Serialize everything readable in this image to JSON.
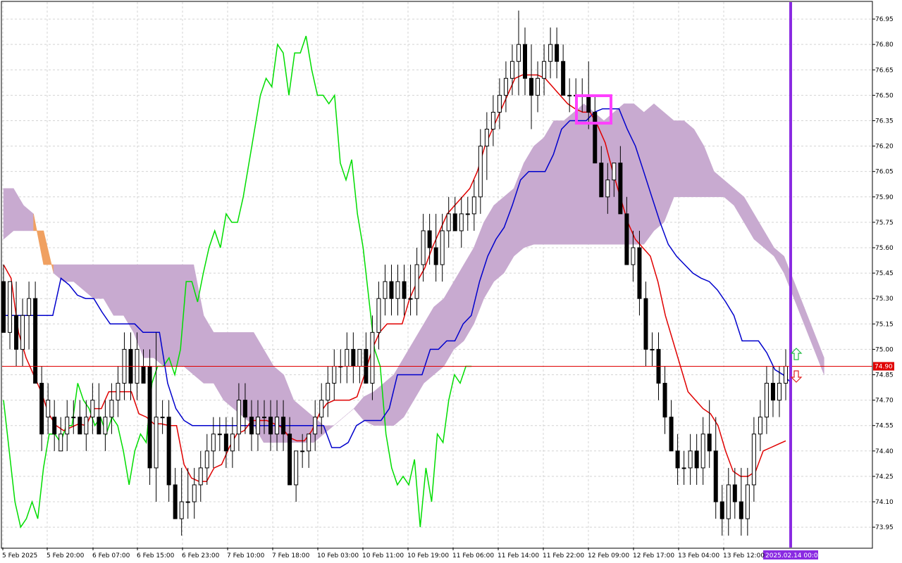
{
  "colors": {
    "background": "#ffffff",
    "grid": "#d4d4d4",
    "bull_candle": "#ffffff",
    "bear_candle": "#000000",
    "tenkan": "#e00000",
    "kijun": "#0000cc",
    "chikou": "#00dd00",
    "kumo_bull": "#c8aad0",
    "kumo_bear": "#f0a060",
    "current_price_line": "#e00000",
    "current_time_line": "#8a2be2",
    "highlight_box": "#ff40ff",
    "price_tag_bg": "#e00000",
    "date_tag_bg": "#8a2be2"
  },
  "chart_data": {
    "type": "candlestick",
    "indicator": "Ichimoku Kinko Hyo",
    "ylim": [
      73.83,
      77.05
    ],
    "y_ticks": [
      "76.95",
      "76.80",
      "76.65",
      "76.50",
      "76.35",
      "76.20",
      "76.05",
      "75.90",
      "75.75",
      "75.60",
      "75.45",
      "75.30",
      "75.15",
      "75.00",
      "74.85",
      "74.70",
      "74.55",
      "74.40",
      "74.25",
      "74.10",
      "73.95"
    ],
    "x_tick_labels": [
      "5 Feb 2025",
      "5 Feb 20:00",
      "6 Feb 07:00",
      "6 Feb 15:00",
      "6 Feb 23:00",
      "7 Feb 10:00",
      "7 Feb 18:00",
      "10 Feb 03:00",
      "10 Feb 11:00",
      "10 Feb 19:00",
      "11 Feb 06:00",
      "11 Feb 14:00",
      "11 Feb 22:00",
      "12 Feb 09:00",
      "12 Feb 17:00",
      "13 Feb 04:00",
      "13 Feb 12:00"
    ],
    "current_price": "74.90",
    "current_time_label": "2025.02.14 00:00",
    "candles": [
      [
        75.4,
        75.5,
        75.2,
        75.1
      ],
      [
        75.1,
        75.3,
        75.0,
        75.4
      ],
      [
        75.2,
        75.4,
        74.9,
        75.0
      ],
      [
        75.0,
        75.3,
        74.9,
        75.2
      ],
      [
        75.2,
        75.4,
        75.0,
        75.3
      ],
      [
        75.3,
        75.4,
        74.9,
        74.8
      ],
      [
        74.8,
        74.9,
        74.4,
        74.5
      ],
      [
        74.6,
        74.8,
        74.5,
        74.7
      ],
      [
        74.6,
        74.7,
        74.4,
        74.5
      ],
      [
        74.4,
        74.6,
        74.4,
        74.5
      ],
      [
        74.5,
        74.7,
        74.4,
        74.6
      ],
      [
        74.6,
        74.7,
        74.5,
        74.6
      ],
      [
        74.6,
        74.7,
        74.5,
        74.5
      ],
      [
        74.5,
        74.7,
        74.4,
        74.6
      ],
      [
        74.6,
        74.8,
        74.5,
        74.7
      ],
      [
        74.6,
        74.8,
        74.5,
        74.5
      ],
      [
        74.5,
        74.7,
        74.4,
        74.6
      ],
      [
        74.6,
        74.8,
        74.5,
        74.7
      ],
      [
        74.7,
        74.9,
        74.6,
        74.8
      ],
      [
        74.8,
        75.1,
        74.7,
        75.0
      ],
      [
        75.0,
        75.1,
        74.7,
        74.8
      ],
      [
        74.8,
        75.1,
        74.7,
        75.0
      ],
      [
        74.9,
        75.0,
        74.8,
        74.8
      ],
      [
        74.9,
        75.0,
        74.2,
        74.3
      ],
      [
        74.3,
        75.1,
        74.1,
        74.6
      ],
      [
        74.6,
        74.7,
        74.5,
        74.6
      ],
      [
        74.6,
        74.7,
        74.1,
        74.2
      ],
      [
        74.2,
        74.3,
        74.0,
        74.0
      ],
      [
        74.0,
        74.3,
        73.9,
        74.1
      ],
      [
        74.1,
        74.3,
        74.0,
        74.1
      ],
      [
        74.1,
        74.3,
        74.0,
        74.2
      ],
      [
        74.2,
        74.4,
        74.1,
        74.3
      ],
      [
        74.3,
        74.5,
        74.2,
        74.4
      ],
      [
        74.4,
        74.6,
        74.3,
        74.5
      ],
      [
        74.5,
        74.6,
        74.4,
        74.5
      ],
      [
        74.5,
        74.6,
        74.3,
        74.4
      ],
      [
        74.4,
        74.6,
        74.3,
        74.5
      ],
      [
        74.5,
        74.8,
        74.4,
        74.7
      ],
      [
        74.7,
        74.8,
        74.5,
        74.6
      ],
      [
        74.6,
        74.7,
        74.4,
        74.5
      ],
      [
        74.5,
        74.7,
        74.4,
        74.6
      ],
      [
        74.6,
        74.7,
        74.5,
        74.6
      ],
      [
        74.6,
        74.7,
        74.4,
        74.5
      ],
      [
        74.5,
        74.7,
        74.4,
        74.6
      ],
      [
        74.6,
        74.7,
        74.4,
        74.5
      ],
      [
        74.5,
        74.6,
        74.2,
        74.2
      ],
      [
        74.2,
        74.4,
        74.1,
        74.4
      ],
      [
        74.4,
        74.5,
        74.3,
        74.4
      ],
      [
        74.4,
        74.5,
        74.3,
        74.5
      ],
      [
        74.5,
        74.7,
        74.4,
        74.6
      ],
      [
        74.6,
        74.8,
        74.5,
        74.7
      ],
      [
        74.7,
        74.9,
        74.6,
        74.8
      ],
      [
        74.8,
        75.0,
        74.7,
        74.9
      ],
      [
        74.9,
        75.0,
        74.8,
        74.9
      ],
      [
        74.9,
        75.1,
        74.8,
        75.0
      ],
      [
        75.0,
        75.1,
        74.8,
        74.9
      ],
      [
        74.9,
        75.0,
        74.8,
        75.0
      ],
      [
        75.0,
        75.1,
        74.9,
        74.8
      ],
      [
        74.8,
        75.2,
        74.7,
        75.1
      ],
      [
        75.1,
        75.4,
        75.0,
        75.3
      ],
      [
        75.3,
        75.5,
        75.2,
        75.4
      ],
      [
        75.4,
        75.5,
        75.2,
        75.3
      ],
      [
        75.3,
        75.5,
        75.2,
        75.4
      ],
      [
        75.4,
        75.5,
        75.2,
        75.3
      ],
      [
        75.3,
        75.5,
        75.2,
        75.3
      ],
      [
        75.3,
        75.6,
        75.2,
        75.5
      ],
      [
        75.5,
        75.8,
        75.4,
        75.7
      ],
      [
        75.7,
        75.8,
        75.5,
        75.6
      ],
      [
        75.6,
        75.8,
        75.4,
        75.5
      ],
      [
        75.5,
        75.8,
        75.4,
        75.7
      ],
      [
        75.7,
        75.9,
        75.6,
        75.8
      ],
      [
        75.8,
        75.9,
        75.7,
        75.7
      ],
      [
        75.7,
        75.9,
        75.6,
        75.8
      ],
      [
        75.8,
        75.9,
        75.7,
        75.8
      ],
      [
        75.8,
        76.0,
        75.7,
        75.9
      ],
      [
        75.9,
        76.3,
        75.8,
        76.2
      ],
      [
        76.2,
        76.4,
        76.0,
        76.3
      ],
      [
        76.3,
        76.5,
        76.2,
        76.4
      ],
      [
        76.4,
        76.6,
        76.3,
        76.5
      ],
      [
        76.5,
        76.7,
        76.4,
        76.6
      ],
      [
        76.6,
        76.8,
        76.5,
        76.7
      ],
      [
        76.7,
        77.0,
        76.5,
        76.8
      ],
      [
        76.8,
        76.9,
        76.5,
        76.6
      ],
      [
        76.6,
        76.8,
        76.3,
        76.5
      ],
      [
        76.5,
        76.7,
        76.4,
        76.6
      ],
      [
        76.6,
        76.8,
        76.5,
        76.7
      ],
      [
        76.7,
        76.9,
        76.6,
        76.8
      ],
      [
        76.8,
        76.9,
        76.6,
        76.7
      ],
      [
        76.7,
        76.8,
        76.5,
        76.5
      ],
      [
        76.5,
        76.6,
        76.4,
        76.5
      ],
      [
        76.5,
        76.6,
        76.4,
        76.5
      ],
      [
        76.5,
        76.6,
        76.4,
        76.5
      ],
      [
        76.5,
        76.7,
        76.3,
        76.4
      ],
      [
        76.4,
        76.5,
        76.1,
        76.1
      ],
      [
        76.1,
        76.2,
        75.9,
        75.9
      ],
      [
        75.9,
        76.1,
        75.8,
        76.0
      ],
      [
        76.0,
        76.1,
        75.9,
        76.1
      ],
      [
        76.1,
        76.2,
        75.8,
        75.8
      ],
      [
        75.8,
        75.9,
        75.5,
        75.5
      ],
      [
        75.5,
        75.7,
        75.4,
        75.6
      ],
      [
        75.6,
        75.7,
        75.2,
        75.3
      ],
      [
        75.3,
        75.4,
        74.9,
        75.0
      ],
      [
        75.0,
        75.1,
        74.9,
        75.0
      ],
      [
        75.0,
        75.1,
        74.7,
        74.8
      ],
      [
        74.8,
        74.9,
        74.5,
        74.6
      ],
      [
        74.6,
        74.7,
        74.4,
        74.4
      ],
      [
        74.4,
        74.5,
        74.2,
        74.3
      ],
      [
        74.3,
        74.4,
        74.2,
        74.3
      ],
      [
        74.3,
        74.5,
        74.2,
        74.4
      ],
      [
        74.4,
        74.5,
        74.2,
        74.3
      ],
      [
        74.3,
        74.6,
        74.2,
        74.5
      ],
      [
        74.5,
        74.7,
        74.3,
        74.4
      ],
      [
        74.4,
        74.6,
        74.0,
        74.1
      ],
      [
        74.1,
        74.2,
        73.9,
        74.0
      ],
      [
        74.0,
        74.3,
        73.9,
        74.2
      ],
      [
        74.2,
        74.3,
        74.0,
        74.1
      ],
      [
        74.1,
        74.3,
        73.9,
        74.0
      ],
      [
        74.0,
        74.3,
        73.9,
        74.2
      ],
      [
        74.2,
        74.6,
        74.1,
        74.5
      ],
      [
        74.5,
        74.7,
        74.4,
        74.6
      ],
      [
        74.6,
        74.9,
        74.5,
        74.8
      ],
      [
        74.8,
        74.9,
        74.6,
        74.7
      ],
      [
        74.7,
        74.9,
        74.6,
        74.8
      ],
      [
        74.8,
        75.0,
        74.7,
        74.9
      ]
    ],
    "tenkan": [
      75.5,
      75.42,
      75.1,
      74.95,
      74.85,
      74.75,
      74.62,
      74.55,
      74.52,
      74.54,
      74.56,
      74.55,
      74.65,
      74.65,
      74.75,
      74.75,
      74.75,
      74.75,
      74.62,
      74.6,
      74.56,
      74.56,
      74.55,
      74.55,
      74.32,
      74.24,
      74.22,
      74.22,
      74.3,
      74.32,
      74.42,
      74.5,
      74.52,
      74.58,
      74.58,
      74.58,
      74.56,
      74.54,
      74.48,
      74.46,
      74.46,
      74.52,
      74.62,
      74.68,
      74.7,
      74.7,
      74.7,
      74.72,
      74.85,
      75.0,
      75.1,
      75.15,
      75.15,
      75.15,
      75.3,
      75.4,
      75.48,
      75.6,
      75.7,
      75.8,
      75.85,
      75.9,
      75.95,
      76.05,
      76.2,
      76.3,
      76.4,
      76.5,
      76.6,
      76.62,
      76.62,
      76.62,
      76.6,
      76.55,
      76.5,
      76.45,
      76.42,
      76.4,
      76.4,
      76.32,
      76.22,
      76.05,
      75.9,
      75.75,
      75.65,
      75.6,
      75.55,
      75.4,
      75.2,
      75.05,
      74.9,
      74.75,
      74.7,
      74.65,
      74.62,
      74.55,
      74.4,
      74.28,
      74.25,
      74.25,
      74.28,
      74.4,
      74.42,
      74.44,
      74.46
    ],
    "kijun": [
      75.2,
      75.2,
      75.2,
      75.2,
      75.2,
      75.2,
      75.2,
      75.42,
      75.38,
      75.32,
      75.3,
      75.3,
      75.22,
      75.15,
      75.15,
      75.15,
      75.15,
      75.1,
      75.1,
      75.1,
      74.8,
      74.65,
      74.58,
      74.55,
      74.55,
      74.55,
      74.55,
      74.55,
      74.55,
      74.55,
      74.55,
      74.55,
      74.55,
      74.55,
      74.55,
      74.55,
      74.55,
      74.55,
      74.55,
      74.55,
      74.42,
      74.42,
      74.45,
      74.55,
      74.58,
      74.58,
      74.58,
      74.65,
      74.85,
      74.85,
      74.85,
      74.85,
      75.0,
      75.0,
      75.05,
      75.05,
      75.15,
      75.2,
      75.4,
      75.55,
      75.65,
      75.72,
      75.85,
      76.0,
      76.05,
      76.05,
      76.05,
      76.15,
      76.3,
      76.35,
      76.35,
      76.35,
      76.4,
      76.42,
      76.42,
      76.42,
      76.3,
      76.2,
      76.05,
      75.9,
      75.75,
      75.62,
      75.55,
      75.5,
      75.45,
      75.42,
      75.4,
      75.35,
      75.28,
      75.2,
      75.05,
      75.05,
      75.05,
      74.98,
      74.88,
      74.85,
      74.8
    ],
    "chikou": [
      74.7,
      74.4,
      74.1,
      73.95,
      74.0,
      74.1,
      74.0,
      74.3,
      74.5,
      74.5,
      74.45,
      74.55,
      74.55,
      74.8,
      74.7,
      74.65,
      74.55,
      74.6,
      74.5,
      74.6,
      74.55,
      74.4,
      74.2,
      74.4,
      74.5,
      74.45,
      74.8,
      74.9,
      74.9,
      74.95,
      74.85,
      75.0,
      75.4,
      75.4,
      75.28,
      75.45,
      75.6,
      75.7,
      75.6,
      75.8,
      75.75,
      75.75,
      75.9,
      76.1,
      76.3,
      76.5,
      76.6,
      76.55,
      76.8,
      76.75,
      76.5,
      76.75,
      76.75,
      76.85,
      76.65,
      76.5,
      76.5,
      76.45,
      76.5,
      76.1,
      76.0,
      76.12,
      75.8,
      75.6,
      75.3,
      75.0,
      74.9,
      74.5,
      74.3,
      74.2,
      74.25,
      74.2,
      74.35,
      73.95,
      74.3,
      74.1,
      74.5,
      74.45,
      74.7,
      74.85,
      74.8,
      74.9,
      74.9
    ],
    "kumo": [
      [
        75.95,
        75.65
      ],
      [
        75.95,
        75.7
      ],
      [
        75.85,
        75.7
      ],
      [
        75.8,
        75.7
      ],
      [
        75.5,
        75.7
      ],
      [
        75.5,
        75.45
      ],
      [
        75.5,
        75.4
      ],
      [
        75.5,
        75.4
      ],
      [
        75.5,
        75.35
      ],
      [
        75.5,
        75.3
      ],
      [
        75.5,
        75.3
      ],
      [
        75.5,
        75.2
      ],
      [
        75.5,
        75.2
      ],
      [
        75.5,
        75.1
      ],
      [
        75.5,
        74.95
      ],
      [
        75.5,
        74.95
      ],
      [
        75.5,
        74.9
      ],
      [
        75.5,
        74.9
      ],
      [
        75.5,
        74.9
      ],
      [
        75.5,
        74.85
      ],
      [
        75.2,
        74.8
      ],
      [
        75.1,
        74.8
      ],
      [
        75.1,
        74.7
      ],
      [
        75.1,
        74.65
      ],
      [
        75.1,
        74.6
      ],
      [
        75.1,
        74.55
      ],
      [
        75.0,
        74.45
      ],
      [
        74.9,
        74.45
      ],
      [
        74.85,
        74.45
      ],
      [
        74.7,
        74.45
      ],
      [
        74.65,
        74.45
      ],
      [
        74.6,
        74.45
      ],
      [
        74.55,
        74.5
      ],
      [
        74.55,
        74.55
      ],
      [
        74.6,
        74.6
      ],
      [
        74.65,
        74.65
      ],
      [
        74.72,
        74.58
      ],
      [
        74.75,
        74.55
      ],
      [
        74.8,
        74.55
      ],
      [
        74.85,
        74.55
      ],
      [
        74.95,
        74.6
      ],
      [
        75.05,
        74.7
      ],
      [
        75.15,
        74.8
      ],
      [
        75.25,
        74.85
      ],
      [
        75.3,
        74.9
      ],
      [
        75.4,
        75.0
      ],
      [
        75.5,
        75.05
      ],
      [
        75.6,
        75.15
      ],
      [
        75.75,
        75.3
      ],
      [
        75.85,
        75.4
      ],
      [
        75.9,
        75.45
      ],
      [
        75.95,
        75.55
      ],
      [
        76.1,
        75.6
      ],
      [
        76.2,
        75.62
      ],
      [
        76.25,
        75.62
      ],
      [
        76.35,
        75.62
      ],
      [
        76.35,
        75.62
      ],
      [
        76.4,
        75.62
      ],
      [
        76.45,
        75.62
      ],
      [
        76.4,
        75.62
      ],
      [
        76.35,
        75.62
      ],
      [
        76.4,
        75.62
      ],
      [
        76.45,
        75.62
      ],
      [
        76.45,
        75.62
      ],
      [
        76.4,
        75.62
      ],
      [
        76.45,
        75.7
      ],
      [
        76.4,
        75.75
      ],
      [
        76.35,
        75.9
      ],
      [
        76.35,
        75.9
      ],
      [
        76.3,
        75.9
      ],
      [
        76.2,
        75.9
      ],
      [
        76.05,
        75.9
      ],
      [
        76.0,
        75.9
      ],
      [
        75.95,
        75.85
      ],
      [
        75.9,
        75.75
      ],
      [
        75.8,
        75.65
      ],
      [
        75.7,
        75.6
      ],
      [
        75.6,
        75.55
      ],
      [
        75.55,
        75.45
      ],
      [
        75.4,
        75.3
      ],
      [
        75.25,
        75.15
      ],
      [
        75.1,
        75.0
      ],
      [
        74.95,
        74.85
      ]
    ]
  }
}
